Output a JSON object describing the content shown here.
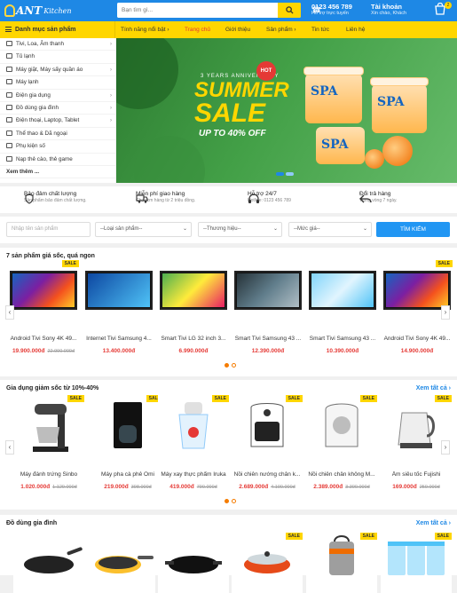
{
  "header": {
    "logo_text": "ANT",
    "logo_sub": "Kitchen",
    "search_placeholder": "Bạn tìm gì...",
    "phone": "0123 456 789",
    "phone_sub": "Hỗ trợ trực tuyến",
    "account": "Tài khoản",
    "account_sub": "Xin chào, Khách",
    "cart_count": "2"
  },
  "nav": {
    "category_label": "Danh mục sản phẩm",
    "items": [
      {
        "label": "Tính năng nổi bật ›",
        "active": false
      },
      {
        "label": "Trang chủ",
        "active": true
      },
      {
        "label": "Giới thiệu",
        "active": false
      },
      {
        "label": "Sản phẩm ›",
        "active": false
      },
      {
        "label": "Tin tức",
        "active": false
      },
      {
        "label": "Liên hệ",
        "active": false
      }
    ]
  },
  "sidebar": {
    "items": [
      {
        "label": "Tivi, Loa, Âm thanh",
        "arrow": true
      },
      {
        "label": "Tủ lạnh",
        "arrow": false
      },
      {
        "label": "Máy giặt, Máy sấy quần áo",
        "arrow": true
      },
      {
        "label": "Máy lạnh",
        "arrow": false
      },
      {
        "label": "Điện gia dụng",
        "arrow": true
      },
      {
        "label": "Đồ dùng gia đình",
        "arrow": true
      },
      {
        "label": "Điện thoại, Laptop, Tablet",
        "arrow": true
      },
      {
        "label": "Thể thao & Dã ngoại",
        "arrow": false
      },
      {
        "label": "Phụ kiện số",
        "arrow": false
      },
      {
        "label": "Nạp thẻ cào, thẻ game",
        "arrow": false
      }
    ],
    "more": "Xem thêm ..."
  },
  "banner": {
    "anniversary": "3 YEARS ANNIVERSARY",
    "hot": "HOT",
    "summer": "SUMMER",
    "sale": "SALE",
    "discount": "UP TO 40% OFF",
    "jar_label": "SPA"
  },
  "services": [
    {
      "title": "Bảo đảm chất lượng",
      "sub": "Sản phẩm bảo đảm chất lượng.",
      "icon": "shield-icon"
    },
    {
      "title": "Miễn phí giao hàng",
      "sub": "Cho đơn hàng từ 2 triệu đồng.",
      "icon": "truck-icon"
    },
    {
      "title": "Hỗ trợ 24/7",
      "sub": "Hotline: 0123 456 789",
      "icon": "headset-icon"
    },
    {
      "title": "Đổi trả hàng",
      "sub": "Trong vòng 7 ngày.",
      "icon": "return-icon"
    }
  ],
  "filter": {
    "name_placeholder": "Nhập tên sản phẩm",
    "type": "--Loại sản phẩm--",
    "brand": "--Thương hiệu--",
    "price": "--Mức giá--",
    "button": "TÌM KIẾM"
  },
  "sections": [
    {
      "title": "7 sản phẩm giá sốc, quá ngon",
      "see_all": "",
      "products": [
        {
          "name": "Android Tivi Sony 4K 49...",
          "price": "19.900.000đ",
          "old": "22.990.000đ",
          "sale": "SALE"
        },
        {
          "name": "Internet Tivi Samsung 4...",
          "price": "13.400.000đ",
          "old": "",
          "sale": ""
        },
        {
          "name": "Smart Tivi LG 32 inch 3...",
          "price": "6.990.000đ",
          "old": "",
          "sale": ""
        },
        {
          "name": "Smart Tivi Samsung 43 ...",
          "price": "12.390.000đ",
          "old": "",
          "sale": ""
        },
        {
          "name": "Smart Tivi Samsung 43 ...",
          "price": "10.390.000đ",
          "old": "",
          "sale": ""
        },
        {
          "name": "Android Tivi Sony 4K 49...",
          "price": "14.900.000đ",
          "old": "",
          "sale": "SALE"
        }
      ]
    },
    {
      "title": "Gia dụng giảm sốc từ 10%-40%",
      "see_all": "Xem tất cả ›",
      "products": [
        {
          "name": "Máy đánh trứng Sinbo",
          "price": "1.020.000đ",
          "old": "1.129.000đ",
          "sale": "SALE"
        },
        {
          "name": "Máy pha cà phê Omi",
          "price": "219.000đ",
          "old": "398.000đ",
          "sale": "SALE"
        },
        {
          "name": "Máy xay thực phẩm Iruka",
          "price": "419.000đ",
          "old": "790.000đ",
          "sale": "SALE"
        },
        {
          "name": "Nồi chiên nướng chân k...",
          "price": "2.689.000đ",
          "old": "4.190.000đ",
          "sale": "SALE"
        },
        {
          "name": "Nồi chiên chân không M...",
          "price": "2.389.000đ",
          "old": "3.390.000đ",
          "sale": "SALE"
        },
        {
          "name": "Ấm siêu tốc Fujishi",
          "price": "169.000đ",
          "old": "259.000đ",
          "sale": "SALE"
        }
      ]
    },
    {
      "title": "Đồ dùng gia đình",
      "see_all": "Xem tất cả ›",
      "products": [
        {
          "name": "",
          "price": "",
          "old": "",
          "sale": ""
        },
        {
          "name": "",
          "price": "",
          "old": "",
          "sale": ""
        },
        {
          "name": "",
          "price": "",
          "old": "",
          "sale": ""
        },
        {
          "name": "",
          "price": "",
          "old": "",
          "sale": "SALE"
        },
        {
          "name": "",
          "price": "",
          "old": "",
          "sale": "SALE"
        },
        {
          "name": "",
          "price": "",
          "old": "",
          "sale": "SALE"
        }
      ]
    }
  ],
  "colors": {
    "primary": "#1e88e5",
    "accent": "#ffd600",
    "price": "#e53935"
  }
}
